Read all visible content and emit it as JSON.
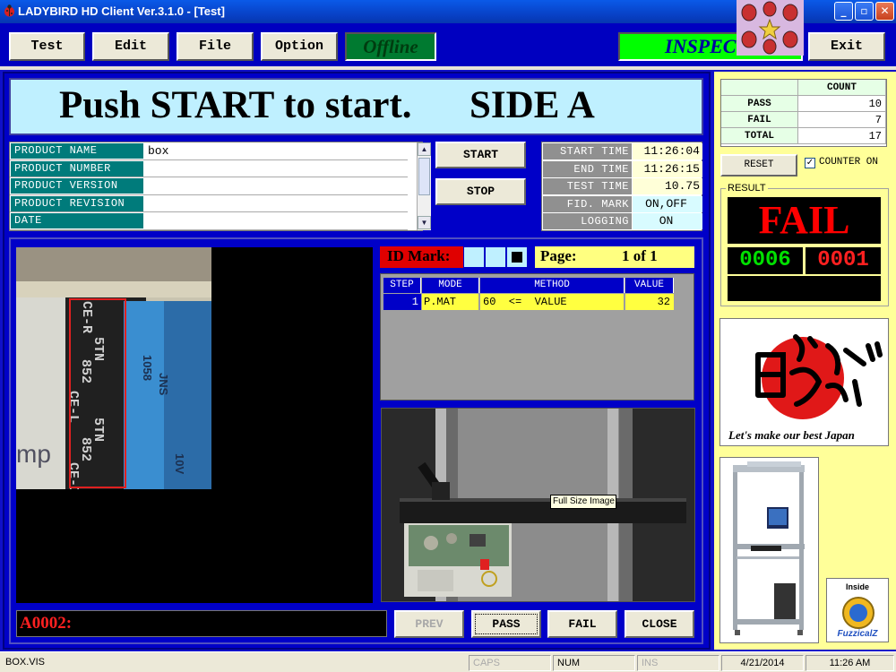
{
  "window": {
    "title": "LADYBIRD HD Client Ver.3.1.0 - [Test]"
  },
  "toolbar": {
    "test_label": "Test",
    "edit_label": "Edit",
    "file_label": "File",
    "option_label": "Option",
    "offline_label": "Offline",
    "inspect_label": "INSPEC",
    "exit_label": "Exit"
  },
  "banner": {
    "text": "Push START to start.      SIDE A"
  },
  "product": {
    "rows": [
      {
        "label": "PRODUCT NAME",
        "value": "box"
      },
      {
        "label": "PRODUCT NUMBER",
        "value": ""
      },
      {
        "label": "PRODUCT VERSION",
        "value": ""
      },
      {
        "label": "PRODUCT REVISION",
        "value": ""
      },
      {
        "label": "DATE",
        "value": ""
      }
    ]
  },
  "controls": {
    "start_label": "START",
    "stop_label": "STOP"
  },
  "timing": {
    "rows": [
      {
        "label": "START TIME",
        "value": "11:26:04"
      },
      {
        "label": "END TIME",
        "value": "11:26:15"
      },
      {
        "label": "TEST TIME",
        "value": "10.75"
      },
      {
        "label": "FID. MARK",
        "value": "ON,OFF"
      },
      {
        "label": "LOGGING",
        "value": "ON"
      }
    ]
  },
  "idmark": {
    "label": "ID Mark:",
    "page_label": "Page:",
    "page_value": "1 of 1"
  },
  "steps": {
    "headers": {
      "step": "STEP",
      "mode": "MODE",
      "method": "METHOD",
      "value": "VALUE"
    },
    "rows": [
      {
        "step": "1",
        "mode": "P.MAT",
        "method": "60  <=  VALUE",
        "value": "32"
      }
    ]
  },
  "tooltip": "Full Size Image",
  "footer": {
    "code": "A0002:",
    "prev_label": "PREV",
    "pass_label": "PASS",
    "fail_label": "FAIL",
    "close_label": "CLOSE"
  },
  "counter": {
    "header": "COUNT",
    "rows": [
      {
        "label": "PASS",
        "value": "10"
      },
      {
        "label": "FAIL",
        "value": "7"
      },
      {
        "label": "TOTAL",
        "value": "17"
      }
    ],
    "reset_label": "RESET",
    "counter_on_label": "COUNTER ON",
    "counter_on_checked": true
  },
  "result": {
    "group_label": "RESULT",
    "status": "FAIL",
    "left_count": "0006",
    "right_count": "0001",
    "fail_color": "#ff0000",
    "left_count_color": "#00e000"
  },
  "logos": {
    "japan_tagline": "Let's make our best Japan",
    "fuzzical_inside": "Inside",
    "fuzzical_name": "FuzzicalZ"
  },
  "statusbar": {
    "file": "BOX.VIS",
    "caps": "CAPS",
    "num": "NUM",
    "ins": "INS",
    "date": "4/21/2014",
    "time": "11:26 AM"
  }
}
